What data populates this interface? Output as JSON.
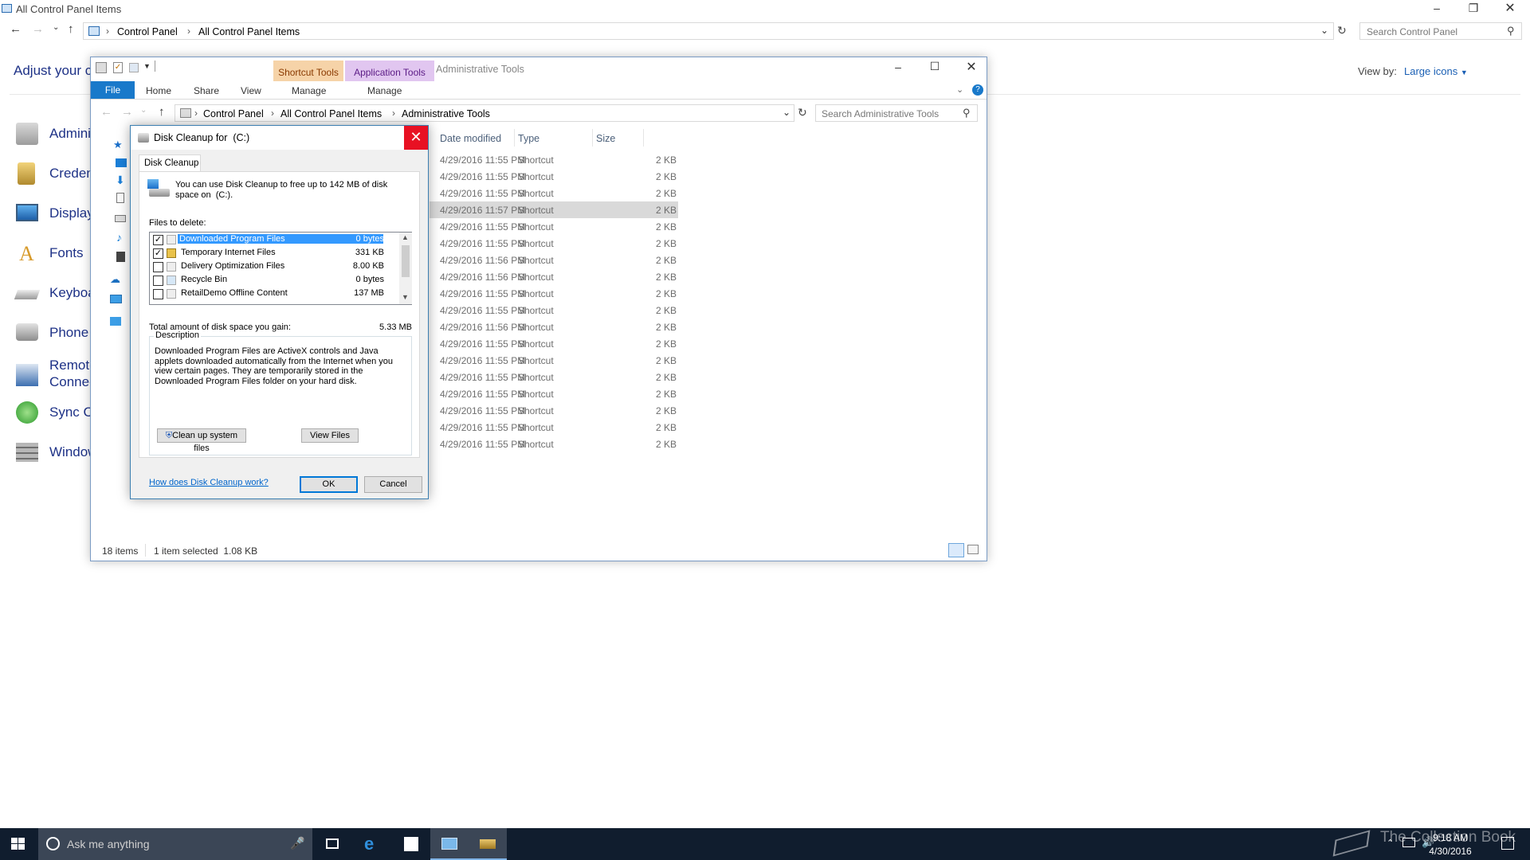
{
  "control_panel": {
    "title": "All Control Panel Items",
    "breadcrumb": [
      "Control Panel",
      "All Control Panel Items"
    ],
    "search_placeholder": "Search Control Panel",
    "heading": "Adjust your co",
    "view_by_label": "View by:",
    "view_by_value": "Large icons",
    "items": [
      {
        "label": "Admini",
        "icon": "admin-tools-icon"
      },
      {
        "label": "Creden",
        "icon": "credential-manager-icon"
      },
      {
        "label": "Display",
        "icon": "display-icon"
      },
      {
        "label": "Fonts",
        "icon": "fonts-icon"
      },
      {
        "label": "Keyboa",
        "icon": "keyboard-icon"
      },
      {
        "label": "Phone a",
        "icon": "phone-modem-icon"
      },
      {
        "label": "Remote",
        "label2": "Connec",
        "icon": "remoteapp-icon"
      },
      {
        "label": "Sync Ce",
        "icon": "sync-center-icon"
      },
      {
        "label": "Window",
        "icon": "windows-firewall-icon"
      }
    ]
  },
  "admin_tools": {
    "title": "Administrative Tools",
    "ribbon_tabs": [
      "File",
      "Home",
      "Share",
      "View",
      "Manage",
      "Manage"
    ],
    "context_tabs": [
      "Shortcut Tools",
      "Application Tools"
    ],
    "breadcrumb": [
      "Control Panel",
      "All Control Panel Items",
      "Administrative Tools"
    ],
    "search_placeholder": "Search Administrative Tools",
    "columns": [
      "Date modified",
      "Type",
      "Size"
    ],
    "rows": [
      {
        "date": "4/29/2016 11:55 PM",
        "type": "Shortcut",
        "size": "2 KB"
      },
      {
        "date": "4/29/2016 11:55 PM",
        "type": "Shortcut",
        "size": "2 KB"
      },
      {
        "date": "4/29/2016 11:55 PM",
        "type": "Shortcut",
        "size": "2 KB"
      },
      {
        "date": "4/29/2016 11:57 PM",
        "type": "Shortcut",
        "size": "2 KB"
      },
      {
        "date": "4/29/2016 11:55 PM",
        "type": "Shortcut",
        "size": "2 KB"
      },
      {
        "date": "4/29/2016 11:55 PM",
        "type": "Shortcut",
        "size": "2 KB"
      },
      {
        "date": "4/29/2016 11:56 PM",
        "type": "Shortcut",
        "size": "2 KB"
      },
      {
        "date": "4/29/2016 11:56 PM",
        "type": "Shortcut",
        "size": "2 KB"
      },
      {
        "date": "4/29/2016 11:55 PM",
        "type": "Shortcut",
        "size": "2 KB"
      },
      {
        "date": "4/29/2016 11:55 PM",
        "type": "Shortcut",
        "size": "2 KB"
      },
      {
        "date": "4/29/2016 11:56 PM",
        "type": "Shortcut",
        "size": "2 KB"
      },
      {
        "date": "4/29/2016 11:55 PM",
        "type": "Shortcut",
        "size": "2 KB"
      },
      {
        "date": "4/29/2016 11:55 PM",
        "type": "Shortcut",
        "size": "2 KB"
      },
      {
        "date": "4/29/2016 11:55 PM",
        "type": "Shortcut",
        "size": "2 KB"
      },
      {
        "date": "4/29/2016 11:55 PM",
        "type": "Shortcut",
        "size": "2 KB"
      },
      {
        "date": "4/29/2016 11:55 PM",
        "type": "Shortcut",
        "size": "2 KB"
      },
      {
        "date": "4/29/2016 11:55 PM",
        "type": "Shortcut",
        "size": "2 KB"
      },
      {
        "date": "4/29/2016 11:55 PM",
        "type": "Shortcut",
        "size": "2 KB"
      }
    ],
    "status_count": "18 items",
    "status_selected": "1 item selected  1.08 KB"
  },
  "disk_cleanup": {
    "title": "Disk Cleanup for  (C:)",
    "tab": "Disk Cleanup",
    "intro": "You can use Disk Cleanup to free up to 142 MB of disk space on  (C:).",
    "files_label": "Files to delete:",
    "files": [
      {
        "name": "Downloaded Program Files",
        "size": "0 bytes",
        "checked": true
      },
      {
        "name": "Temporary Internet Files",
        "size": "331 KB",
        "checked": true
      },
      {
        "name": "Delivery Optimization Files",
        "size": "8.00 KB",
        "checked": false
      },
      {
        "name": "Recycle Bin",
        "size": "0 bytes",
        "checked": false
      },
      {
        "name": "RetailDemo Offline Content",
        "size": "137 MB",
        "checked": false
      }
    ],
    "total_label": "Total amount of disk space you gain:",
    "total_value": "5.33 MB",
    "description_label": "Description",
    "description": "Downloaded Program Files are ActiveX controls and Java applets downloaded automatically from the Internet when you view certain pages. They are temporarily stored in the Downloaded Program Files folder on your hard disk.",
    "cleanup_system_button": "Clean up system files",
    "view_files_button": "View Files",
    "help_link": "How does Disk Cleanup work?",
    "ok_button": "OK",
    "cancel_button": "Cancel"
  },
  "taskbar": {
    "search_placeholder": "Ask me anything",
    "time": "9:18 AM",
    "date": "4/30/2016",
    "watermark": "The Collection Book"
  }
}
